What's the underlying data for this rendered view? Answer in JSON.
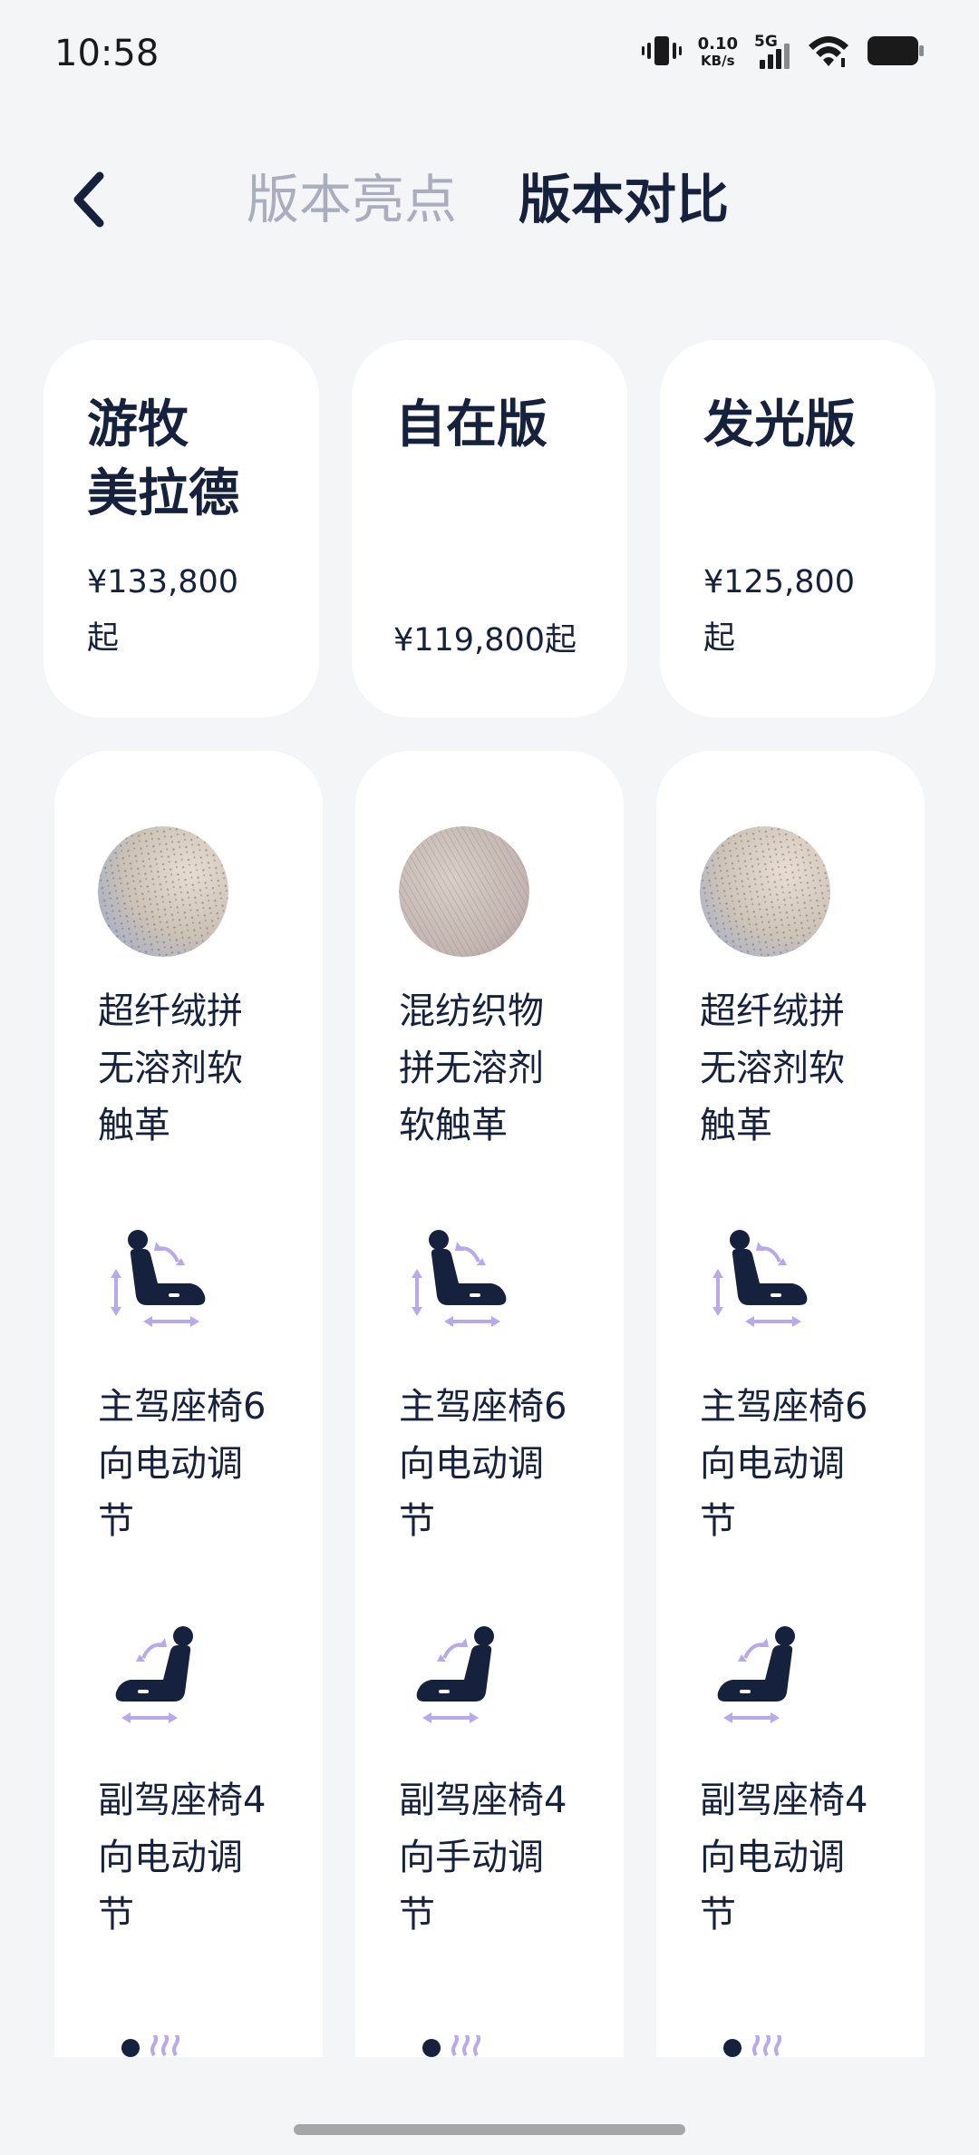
{
  "status_bar": {
    "time": "10:58",
    "net_speed_value": "0.10",
    "net_speed_unit": "KB/s",
    "network_type": "5G",
    "icons": [
      "vibrate-icon",
      "signal-icon",
      "wifi-icon",
      "battery-icon"
    ]
  },
  "nav": {
    "back_icon": "chevron-left-icon",
    "tabs": [
      {
        "label": "版本亮点",
        "active": false
      },
      {
        "label": "版本对比",
        "active": true
      }
    ]
  },
  "versions": [
    {
      "name": "游牧\n美拉德",
      "price": "¥133,800\n起"
    },
    {
      "name": "自在版",
      "price": "¥119,800起"
    },
    {
      "name": "发光版",
      "price": "¥125,800\n起"
    }
  ],
  "specs": [
    {
      "material_icon": "fabric-swatch-icon",
      "material": "超纤绒拼\n无溶剂软\n触革",
      "driver_seat_icon": "driver-seat-adjust-icon",
      "driver_seat": "主驾座椅6\n向电动调\n节",
      "passenger_seat_icon": "passenger-seat-adjust-icon",
      "passenger_seat": "副驾座椅4\n向电动调\n节"
    },
    {
      "material_icon": "fabric-swatch-icon",
      "material": "混纺织物\n拼无溶剂\n软触革",
      "driver_seat_icon": "driver-seat-adjust-icon",
      "driver_seat": "主驾座椅6\n向电动调\n节",
      "passenger_seat_icon": "passenger-seat-adjust-icon",
      "passenger_seat": "副驾座椅4\n向手动调\n节"
    },
    {
      "material_icon": "fabric-swatch-icon",
      "material": "超纤绒拼\n无溶剂软\n触革",
      "driver_seat_icon": "driver-seat-adjust-icon",
      "driver_seat": "主驾座椅6\n向电动调\n节",
      "passenger_seat_icon": "passenger-seat-adjust-icon",
      "passenger_seat": "副驾座椅4\n向电动调\n节"
    }
  ],
  "colors": {
    "background": "#f4f5f7",
    "card": "#ffffff",
    "text_primary": "#16213e",
    "tab_inactive": "#a9adbd",
    "icon_accent": "#b8a9ec"
  }
}
